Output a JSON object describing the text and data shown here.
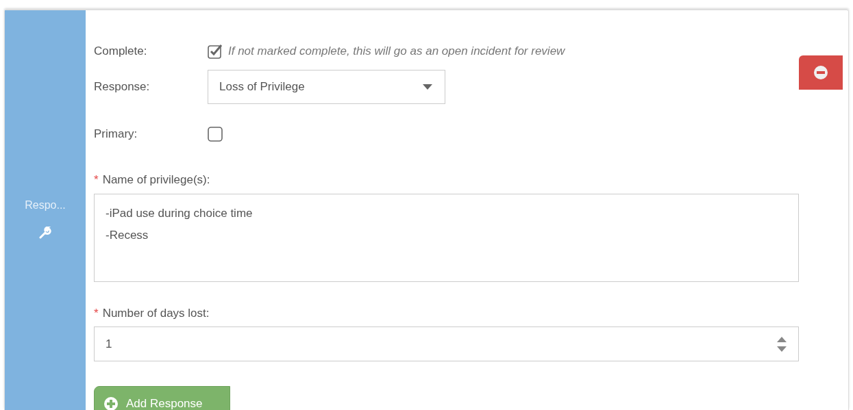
{
  "sidebar": {
    "label": "Respo..."
  },
  "fields": [
    {
      "kind": "checkbox",
      "label": "Complete:",
      "checked": true,
      "hint": "If not marked complete, this will go as an open incident for review"
    },
    {
      "kind": "select",
      "label": "Response:",
      "value": "Loss of Privilege"
    },
    {
      "kind": "checkbox",
      "label": "Primary:",
      "checked": false
    },
    {
      "kind": "textarea",
      "marker": "*",
      "label": "Name of privilege(s):",
      "lines": [
        "-iPad use during choice time",
        "-Recess"
      ]
    },
    {
      "kind": "number",
      "marker": "*",
      "label": "Number of days lost:",
      "value": "1"
    }
  ],
  "add_button": {
    "label": "Add Response"
  }
}
